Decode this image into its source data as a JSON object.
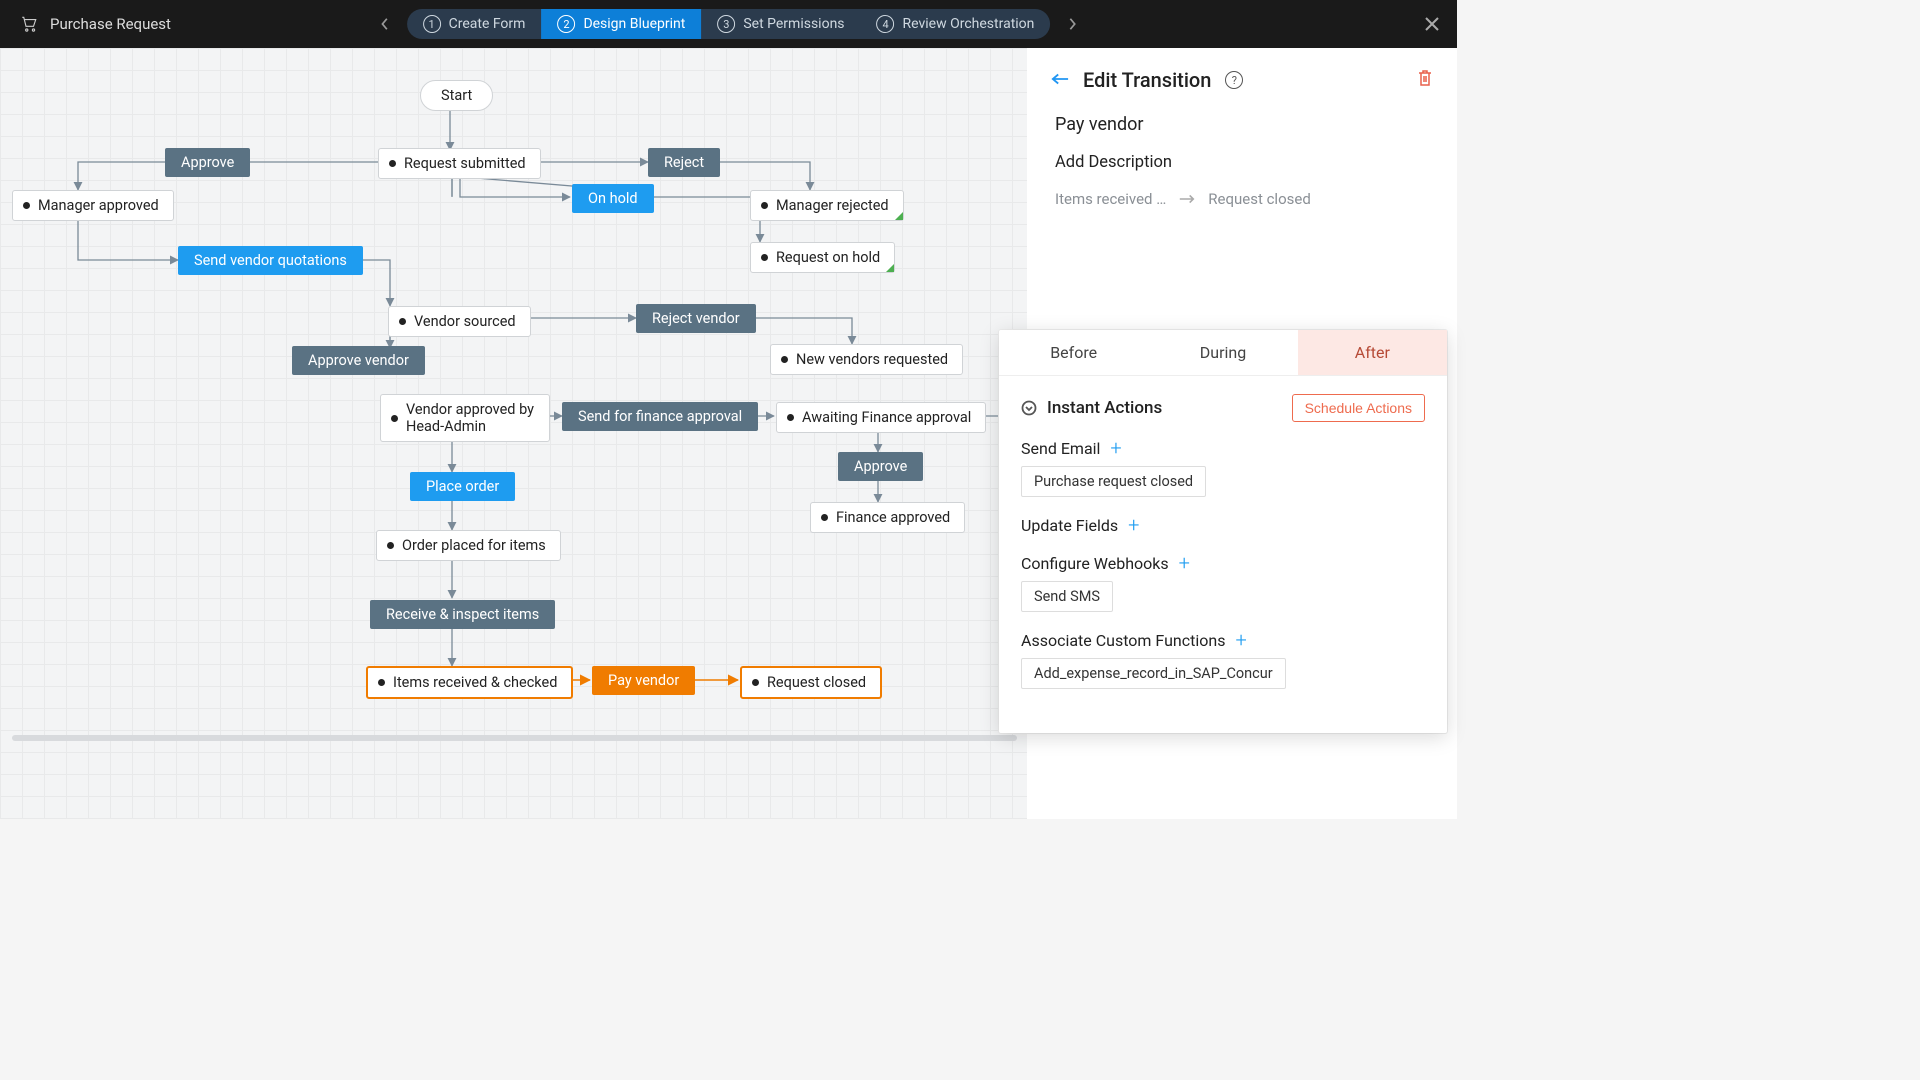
{
  "header": {
    "title": "Purchase Request",
    "steps": [
      {
        "num": "1",
        "label": "Create Form",
        "active": false
      },
      {
        "num": "2",
        "label": "Design Blueprint",
        "active": true
      },
      {
        "num": "3",
        "label": "Set Permissions",
        "active": false
      },
      {
        "num": "4",
        "label": "Review Orchestration",
        "active": false
      }
    ]
  },
  "flow": {
    "start": "Start",
    "nodes": {
      "request_submitted": "Request submitted",
      "manager_approved": "Manager approved",
      "manager_rejected": "Manager rejected",
      "request_on_hold": "Request on hold",
      "vendor_sourced": "Vendor sourced",
      "new_vendors_requested": "New vendors requested",
      "vendor_approved": "Vendor approved by Head-Admin",
      "awaiting_finance": "Awaiting Finance approval",
      "finance_approved": "Finance approved",
      "order_placed": "Order placed for items",
      "items_received": "Items received & checked",
      "request_closed": "Request closed"
    },
    "transitions": {
      "approve1": "Approve",
      "reject1": "Reject",
      "on_hold": "On hold",
      "send_vendor_quotations": "Send vendor quotations",
      "reject_vendor": "Reject vendor",
      "approve_vendor": "Approve vendor",
      "send_finance": "Send for finance approval",
      "approve2": "Approve",
      "place_order": "Place order",
      "receive_inspect": "Receive & inspect items",
      "pay_vendor": "Pay vendor"
    }
  },
  "panel": {
    "heading": "Edit Transition",
    "title": "Pay vendor",
    "add_description": "Add Description",
    "from": "Items received …",
    "to": "Request closed"
  },
  "card": {
    "tabs": [
      "Before",
      "During",
      "After"
    ],
    "active_tab": "After",
    "section": "Instant Actions",
    "schedule": "Schedule Actions",
    "actions": {
      "send_email": {
        "label": "Send Email",
        "chip": "Purchase request closed"
      },
      "update_fields": {
        "label": "Update Fields"
      },
      "webhooks": {
        "label": "Configure Webhooks",
        "chip": "Send SMS"
      },
      "custom_fn": {
        "label": "Associate Custom Functions",
        "chip": "Add_expense_record_in_SAP_Concur"
      }
    }
  }
}
